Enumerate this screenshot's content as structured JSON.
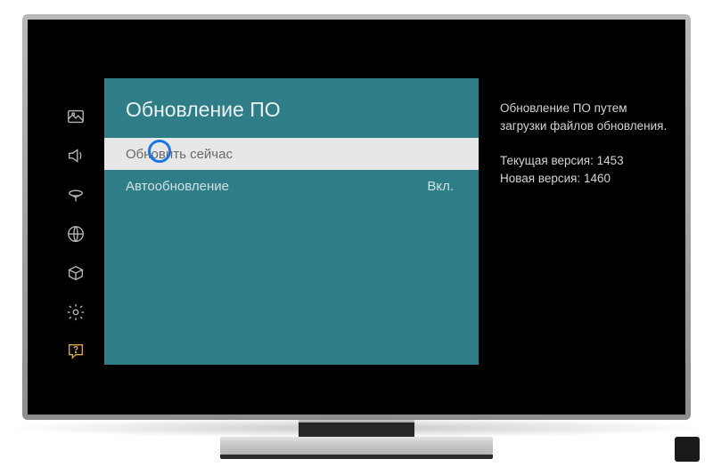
{
  "panel": {
    "title": "Обновление ПО",
    "items": [
      {
        "label": "Обновить сейчас",
        "value": ""
      },
      {
        "label": "Автообновление",
        "value": "Вкл."
      }
    ]
  },
  "info": {
    "description": "Обновление ПО путем загрузки файлов обновления.",
    "current_label": "Текущая версия:",
    "current_value": "1453",
    "new_label": "Новая версия:",
    "new_value": "1460"
  },
  "nav": {
    "picture": "picture-icon",
    "sound": "sound-icon",
    "broadcast": "broadcast-icon",
    "network": "network-icon",
    "system": "system-icon",
    "settings": "settings-icon",
    "support": "support-icon"
  }
}
